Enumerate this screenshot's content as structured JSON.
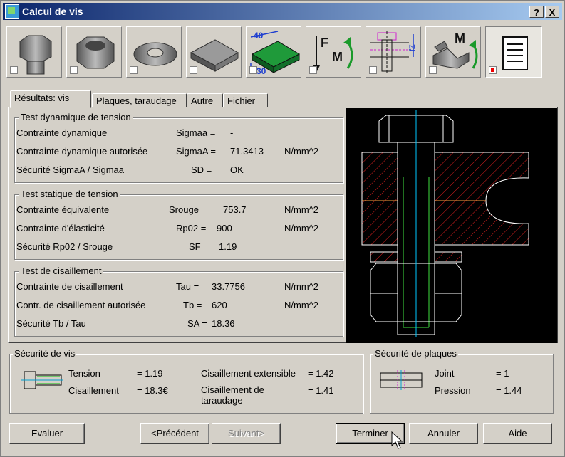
{
  "window": {
    "title": "Calcul de vis",
    "help_label": "?",
    "close_label": "X"
  },
  "tabs": [
    "Résultats: vis",
    "Plaques, taraudage",
    "Autre",
    "Fichier"
  ],
  "groups": {
    "dyn": {
      "title": "Test dynamique de tension",
      "rows": [
        {
          "label": "Contrainte dynamique",
          "sym": "Sigmaa =",
          "val": "-",
          "unit": ""
        },
        {
          "label": "Contrainte dynamique autorisée",
          "sym": "SigmaA =",
          "val": "71.3413",
          "unit": "N/mm^2"
        },
        {
          "label": "Sécurité SigmaA / Sigmaa",
          "sym": "SD =",
          "val": "OK",
          "unit": ""
        }
      ]
    },
    "stat": {
      "title": "Test statique de tension",
      "rows": [
        {
          "label": "Contrainte équivalente",
          "sym": "Srouge =",
          "val": "753.7",
          "unit": "N/mm^2"
        },
        {
          "label": "Contrainte d'élasticité",
          "sym": "Rp02 =",
          "val": "900",
          "unit": "N/mm^2"
        },
        {
          "label": "Sécurité Rp02 / Srouge",
          "sym": "SF =",
          "val": "1.19",
          "unit": ""
        }
      ]
    },
    "shear": {
      "title": "Test de cisaillement",
      "rows": [
        {
          "label": "Contrainte de cisaillement",
          "sym": "Tau =",
          "val": "33.7756",
          "unit": "N/mm^2"
        },
        {
          "label": "Contr. de cisaillement autorisée",
          "sym": "Tb =",
          "val": "620",
          "unit": "N/mm^2"
        },
        {
          "label": "Sécurité Tb / Tau",
          "sym": "SA =",
          "val": "18.36",
          "unit": ""
        }
      ]
    }
  },
  "screw_safety": {
    "title": "Sécurité de vis",
    "tension_label": "Tension",
    "tension_val": "= 1.19",
    "shear_label": "Cisaillement",
    "shear_val": "= 18.3€",
    "ext_label": "Cisaillement extensible",
    "ext_val": "= 1.42",
    "thread_label": "Cisaillement de taraudage",
    "thread_val": "= 1.41"
  },
  "plate_safety": {
    "title": "Sécurité de plaques",
    "joint_label": "Joint",
    "joint_val": "= 1",
    "pressure_label": "Pression",
    "pressure_val": "= 1.44"
  },
  "toolbar": {
    "dim_top": "40",
    "dim_bottom": "30",
    "force_f": "F",
    "force_m": "M",
    "wrench_m": "M",
    "fz": "fZ"
  },
  "buttons": {
    "evaluate": "Evaluer",
    "previous": "<Précédent",
    "next": "Suivant>",
    "finish": "Terminer",
    "cancel": "Annuler",
    "help": "Aide"
  },
  "colors": {
    "title_start": "#0a246a",
    "title_end": "#a6caf0",
    "hatch": "#e02020",
    "axis": "#00c8ff",
    "bolt_inner": "#40e040"
  }
}
